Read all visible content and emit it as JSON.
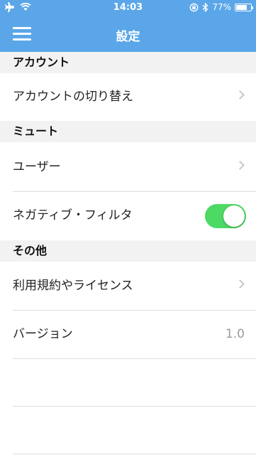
{
  "status": {
    "time": "14:03",
    "battery_text": "77%",
    "battery_level": 0.77,
    "icons": [
      "airplane-icon",
      "wifi-icon",
      "rotation-lock-icon",
      "bluetooth-icon",
      "battery-icon"
    ]
  },
  "nav": {
    "title": "設定",
    "menu_icon": "hamburger-menu-icon"
  },
  "sections": {
    "account": {
      "header": "アカウント",
      "rows": [
        {
          "label": "アカウントの切り替え",
          "icon": "chevron-right-icon"
        }
      ]
    },
    "mute": {
      "header": "ミュート",
      "rows": [
        {
          "label": "ユーザー",
          "icon": "chevron-right-icon"
        },
        {
          "label": "ネガティブ・フィルタ",
          "toggle_on": true
        }
      ]
    },
    "other": {
      "header": "その他",
      "rows": [
        {
          "label": "利用規約やライセンス",
          "icon": "chevron-right-icon"
        },
        {
          "label": "バージョン",
          "value": "1.0"
        }
      ]
    }
  },
  "colors": {
    "accent": "#5aa6e8",
    "toggle_on": "#4cd964",
    "section_bg": "#f2f2f2"
  }
}
